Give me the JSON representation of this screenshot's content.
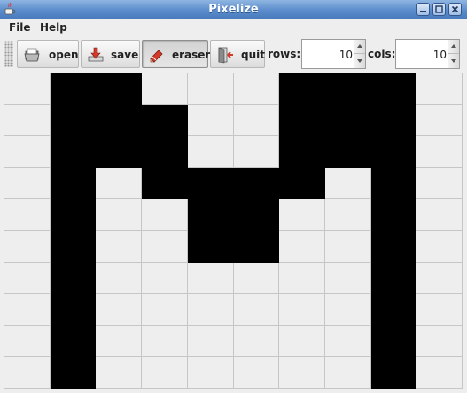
{
  "window": {
    "title": "Pixelize"
  },
  "menu": {
    "file": "File",
    "help": "Help"
  },
  "toolbar": {
    "open_label": "open",
    "save_label": "save",
    "eraser_label": "eraser",
    "quit_label": "quit",
    "rows_label": "rows:",
    "cols_label": "cols:",
    "rows_value": "10",
    "cols_value": "10"
  },
  "pixel_grid": {
    "rows": 10,
    "cols": 10,
    "cells": [
      [
        0,
        1,
        1,
        0,
        0,
        0,
        1,
        1,
        1,
        0
      ],
      [
        0,
        1,
        1,
        1,
        0,
        0,
        1,
        1,
        1,
        0
      ],
      [
        0,
        1,
        1,
        1,
        0,
        0,
        1,
        1,
        1,
        0
      ],
      [
        0,
        1,
        0,
        1,
        1,
        1,
        1,
        0,
        1,
        0
      ],
      [
        0,
        1,
        0,
        0,
        1,
        1,
        0,
        0,
        1,
        0
      ],
      [
        0,
        1,
        0,
        0,
        1,
        1,
        0,
        0,
        1,
        0
      ],
      [
        0,
        1,
        0,
        0,
        0,
        0,
        0,
        0,
        1,
        0
      ],
      [
        0,
        1,
        0,
        0,
        0,
        0,
        0,
        0,
        1,
        0
      ],
      [
        0,
        1,
        0,
        0,
        0,
        0,
        0,
        0,
        1,
        0
      ],
      [
        0,
        1,
        0,
        0,
        0,
        0,
        0,
        0,
        1,
        0
      ]
    ],
    "on_color": "#000000",
    "off_color": "#eeeeee",
    "grid_line_color": "#c6c6c6",
    "canvas_border_color": "#d24a4a"
  },
  "icons": {
    "app": "java-cup-icon",
    "open": "folder-open-icon",
    "save": "save-download-icon",
    "eraser": "eraser-pencil-icon",
    "quit": "exit-door-icon",
    "minimize": "minimize-icon",
    "maximize": "maximize-icon",
    "close": "close-icon"
  }
}
